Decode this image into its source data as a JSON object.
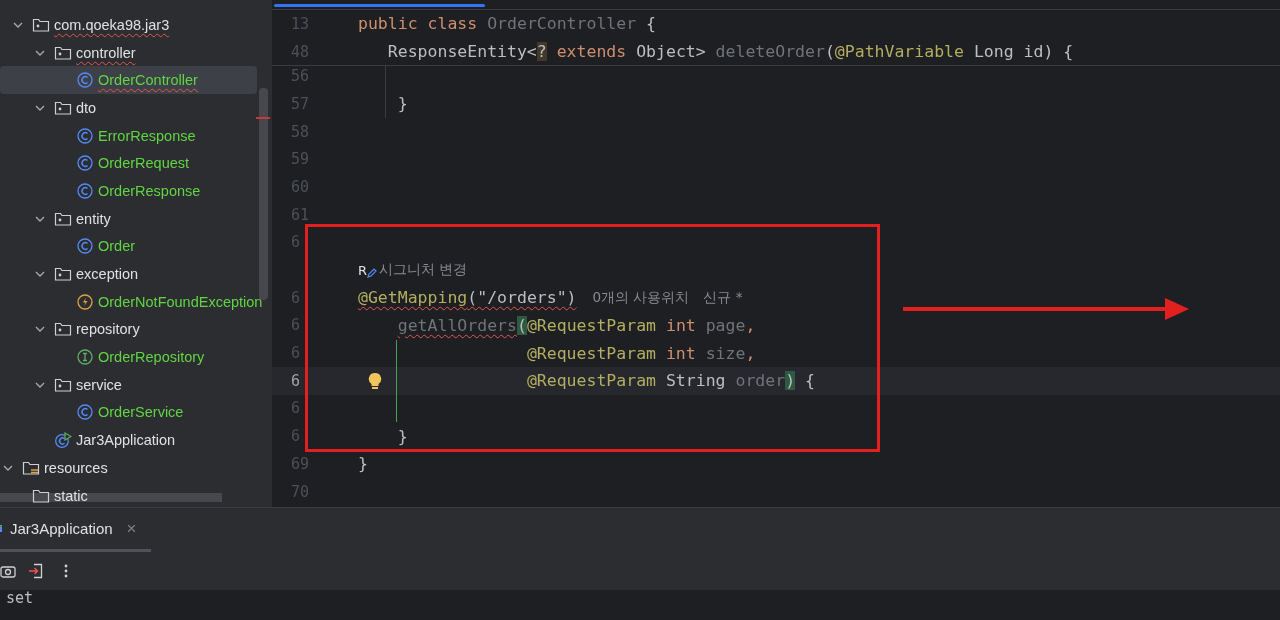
{
  "project_tree": {
    "package_items": [
      {
        "label": "com.qoeka98.jar3",
        "kind": "package",
        "expanded": true,
        "added": false,
        "squiggle": true,
        "selected": false,
        "children": [
          {
            "label": "controller",
            "kind": "package",
            "expanded": true,
            "added": false,
            "squiggle": true,
            "selected": false,
            "children": [
              {
                "label": "OrderController",
                "kind": "class",
                "added": true,
                "squiggle": true,
                "selected": true
              }
            ]
          },
          {
            "label": "dto",
            "kind": "package",
            "expanded": true,
            "added": false,
            "squiggle": false,
            "selected": false,
            "children": [
              {
                "label": "ErrorResponse",
                "kind": "class",
                "added": true,
                "squiggle": false,
                "selected": false
              },
              {
                "label": "OrderRequest",
                "kind": "class",
                "added": true,
                "squiggle": false,
                "selected": false
              },
              {
                "label": "OrderResponse",
                "kind": "class",
                "added": true,
                "squiggle": false,
                "selected": false
              }
            ]
          },
          {
            "label": "entity",
            "kind": "package",
            "expanded": true,
            "added": false,
            "squiggle": false,
            "selected": false,
            "children": [
              {
                "label": "Order",
                "kind": "class",
                "added": true,
                "squiggle": false,
                "selected": false
              }
            ]
          },
          {
            "label": "exception",
            "kind": "package",
            "expanded": true,
            "added": false,
            "squiggle": false,
            "selected": false,
            "children": [
              {
                "label": "OrderNotFoundException",
                "kind": "exception",
                "added": true,
                "squiggle": false,
                "selected": false
              }
            ]
          },
          {
            "label": "repository",
            "kind": "package",
            "expanded": true,
            "added": false,
            "squiggle": false,
            "selected": false,
            "children": [
              {
                "label": "OrderRepository",
                "kind": "interface",
                "added": true,
                "squiggle": false,
                "selected": false
              }
            ]
          },
          {
            "label": "service",
            "kind": "package",
            "expanded": true,
            "added": false,
            "squiggle": false,
            "selected": false,
            "children": [
              {
                "label": "OrderService",
                "kind": "class",
                "added": true,
                "squiggle": false,
                "selected": false
              }
            ]
          },
          {
            "label": "Jar3Application",
            "kind": "app",
            "added": false,
            "squiggle": false,
            "selected": false
          }
        ]
      }
    ],
    "resource_items": [
      {
        "label": "resources",
        "kind": "resources",
        "expanded": true,
        "added": false,
        "squiggle": false,
        "selected": false,
        "children": [
          {
            "label": "static",
            "kind": "folder",
            "added": false,
            "squiggle": false,
            "selected": false
          }
        ]
      }
    ]
  },
  "editor": {
    "sticky_lines": [
      {
        "kind": "code",
        "number": "13",
        "tokens": [
          {
            "text": "public class",
            "kind": "keyword",
            "squiggle": false
          },
          {
            "text": "OrderController",
            "kind": "unused",
            "squiggle": false
          },
          {
            "text": "{",
            "kind": "plain",
            "squiggle": false
          }
        ]
      },
      {
        "kind": "member",
        "number": "48",
        "tokens": [
          {
            "text": "ResponseEntity<",
            "kind": "plain",
            "squiggle": false
          },
          {
            "text": "?",
            "kind": "wildcard",
            "squiggle": false
          },
          {
            "text": "extends",
            "kind": "keyword",
            "squiggle": false
          },
          {
            "text": "Object>",
            "kind": "plain",
            "squiggle": false
          },
          {
            "text": "deleteOrder",
            "kind": "unused",
            "squiggle": false
          },
          {
            "text": "(",
            "kind": "open",
            "squiggle": false
          },
          {
            "text": "@PathVariable",
            "kind": "annotation",
            "squiggle": false
          },
          {
            "text": "Long id) {",
            "kind": "plain",
            "squiggle": false
          }
        ]
      }
    ],
    "lines": [
      {
        "kind": "code",
        "number": "56",
        "current": false,
        "bulb": false
      },
      {
        "kind": "method",
        "number": "57",
        "current": false,
        "bulb": false,
        "tokens": [
          {
            "text": "}",
            "kind": "plain",
            "squiggle": false
          }
        ]
      },
      {
        "kind": "code",
        "number": "58",
        "current": false,
        "bulb": false
      },
      {
        "kind": "code",
        "number": "59",
        "current": false,
        "bulb": false
      },
      {
        "kind": "code",
        "number": "60",
        "current": false,
        "bulb": false
      },
      {
        "kind": "code",
        "number": "61",
        "current": false,
        "bulb": false
      },
      {
        "kind": "code",
        "number": "6",
        "current": false,
        "bulb": false
      },
      {
        "kind": "hint",
        "badge": "R",
        "text": "시그니처 변경"
      },
      {
        "kind": "code",
        "number": "6",
        "current": false,
        "bulb": false,
        "tokens": [
          {
            "text": "@GetMapping",
            "kind": "annotation",
            "squiggle": true
          },
          {
            "text": "(\"/orders\")",
            "kind": "args",
            "squiggle": true
          }
        ],
        "hints": [
          "0개의 사용위치",
          "신규 *"
        ]
      },
      {
        "kind": "method",
        "number": "6",
        "current": false,
        "bulb": false,
        "tokens": [
          {
            "text": "getAllOrders",
            "kind": "unused",
            "squiggle": true
          },
          {
            "text": "(",
            "kind": "open_match",
            "squiggle": false
          },
          {
            "text": "@RequestParam",
            "kind": "annotation",
            "squiggle": false
          },
          {
            "text": "int",
            "kind": "keyword",
            "squiggle": false
          },
          {
            "text": "page",
            "kind": "unused",
            "squiggle": false
          },
          {
            "text": ",",
            "kind": "punct",
            "squiggle": false
          }
        ]
      },
      {
        "kind": "continuation",
        "number": "6",
        "current": false,
        "bulb": false,
        "tokens": [
          {
            "text": "@RequestParam",
            "kind": "annotation",
            "squiggle": false
          },
          {
            "text": "int",
            "kind": "keyword",
            "squiggle": false
          },
          {
            "text": "size",
            "kind": "unused",
            "squiggle": false
          },
          {
            "text": ",",
            "kind": "punct",
            "squiggle": false
          }
        ]
      },
      {
        "kind": "continuation",
        "number": "6",
        "current": true,
        "bulb": true,
        "tokens": [
          {
            "text": "@RequestParam",
            "kind": "annotation",
            "squiggle": false
          },
          {
            "text": "String",
            "kind": "plain",
            "squiggle": false
          },
          {
            "text": "order",
            "kind": "unused",
            "squiggle": false
          },
          {
            "text": ")",
            "kind": "close_match",
            "squiggle": false
          },
          {
            "text": "{",
            "kind": "plain",
            "squiggle": false
          }
        ]
      },
      {
        "kind": "code",
        "number": "6",
        "current": false,
        "bulb": false
      },
      {
        "kind": "method",
        "number": "6",
        "current": false,
        "bulb": false,
        "tokens": [
          {
            "text": "}",
            "kind": "plain",
            "squiggle": false
          }
        ]
      },
      {
        "kind": "code",
        "number": "69",
        "current": false,
        "bulb": false,
        "tokens": [
          {
            "text": "}",
            "kind": "plain",
            "squiggle": false
          }
        ]
      },
      {
        "kind": "code",
        "number": "70",
        "current": false,
        "bulb": false
      }
    ]
  },
  "run_panel": {
    "tabs": [
      {
        "label": "Jar3Application",
        "close": "×",
        "selected": true
      }
    ],
    "console_lines": [
      "set"
    ]
  }
}
